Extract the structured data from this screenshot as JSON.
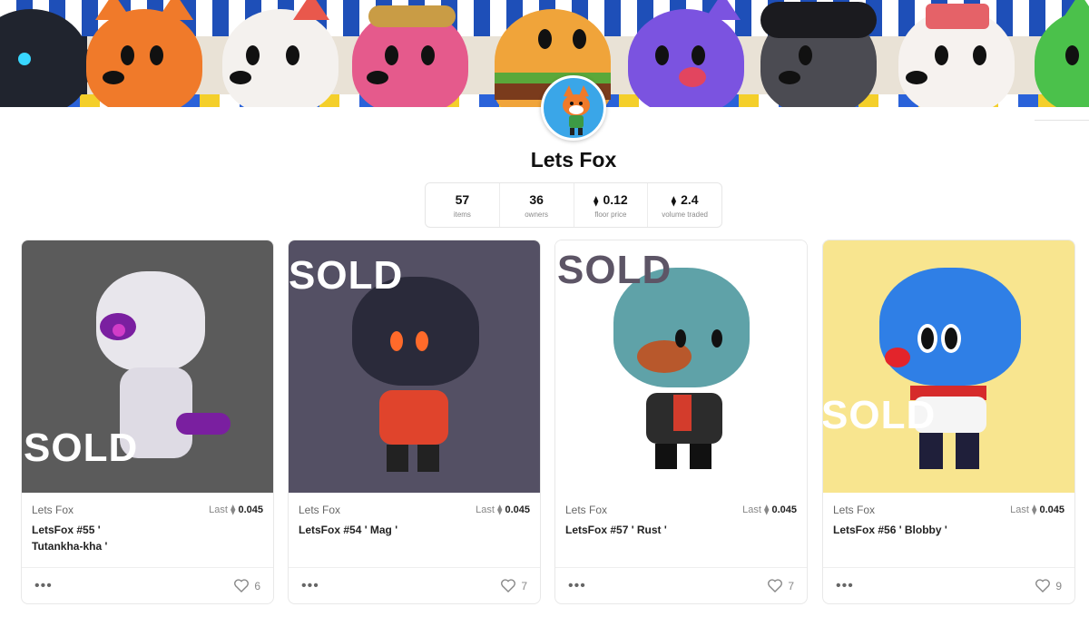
{
  "collection": {
    "title": "Lets Fox"
  },
  "stats": [
    {
      "value": "57",
      "label": "items",
      "eth": false
    },
    {
      "value": "36",
      "label": "owners",
      "eth": false
    },
    {
      "value": "0.12",
      "label": "floor price",
      "eth": true
    },
    {
      "value": "2.4",
      "label": "volume traded",
      "eth": true
    }
  ],
  "cards": [
    {
      "collection": "Lets Fox",
      "last_label": "Last",
      "last_price": "0.045",
      "name_line1": "LetsFox #55 '",
      "name_line2": "Tutankha-kha '",
      "sold": "SOLD",
      "likes": "6"
    },
    {
      "collection": "Lets Fox",
      "last_label": "Last",
      "last_price": "0.045",
      "name_line1": "LetsFox #54 ' Mag '",
      "name_line2": "",
      "sold": "SOLD",
      "likes": "7"
    },
    {
      "collection": "Lets Fox",
      "last_label": "Last",
      "last_price": "0.045",
      "name_line1": "LetsFox #57 ' Rust '",
      "name_line2": "",
      "sold": "SOLD",
      "likes": "7"
    },
    {
      "collection": "Lets Fox",
      "last_label": "Last",
      "last_price": "0.045",
      "name_line1": "LetsFox #56 ' Blobby '",
      "name_line2": "",
      "sold": "SOLD",
      "likes": "9"
    }
  ],
  "icons": {
    "eth": "ethereum-icon",
    "more": "more-dots-icon",
    "like": "heart-icon"
  },
  "colors": {
    "card1_bg": "#5b5b5b",
    "card2_bg": "#545064",
    "card3_bg": "#ffffff",
    "card4_bg": "#f8e58f",
    "avatar_bg": "#3aa6e8"
  }
}
